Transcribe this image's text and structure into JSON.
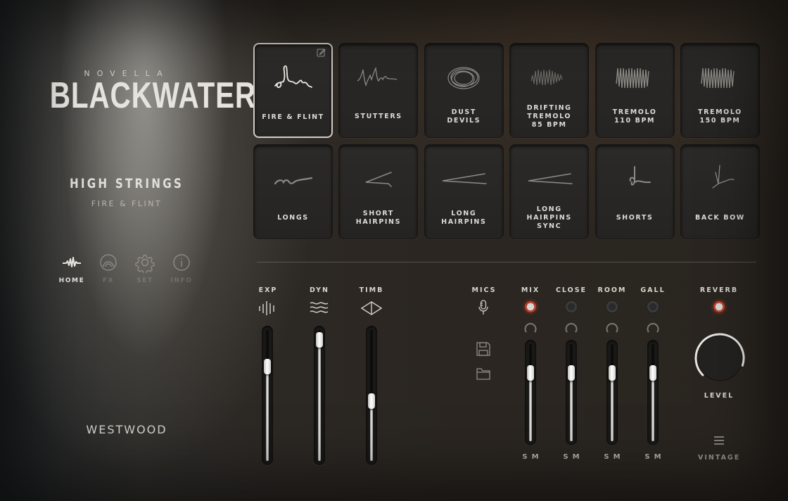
{
  "brand": {
    "subtitle": "NOVELLA",
    "title": "BLACKWATER",
    "maker": "WESTWOOD"
  },
  "patch": {
    "title": "HIGH STRINGS",
    "subtitle": "FIRE & FLINT"
  },
  "nav": [
    {
      "label": "HOME",
      "icon": "waveform-icon",
      "active": true
    },
    {
      "label": "FX",
      "icon": "fx-rings-icon",
      "active": false
    },
    {
      "label": "SET",
      "icon": "gear-icon",
      "active": false
    },
    {
      "label": "INFO",
      "icon": "info-icon",
      "active": false
    }
  ],
  "articulations": [
    {
      "label": "FIRE & FLINT",
      "glyph": "squiggle",
      "selected": true
    },
    {
      "label": "STUTTERS",
      "glyph": "stutter"
    },
    {
      "label": "DUST\nDEVILS",
      "glyph": "circles"
    },
    {
      "label": "DRIFTING\nTREMOLO\n85 BPM",
      "glyph": "tremolo-faint"
    },
    {
      "label": "TREMOLO\n110 BPM",
      "glyph": "tremolo"
    },
    {
      "label": "TREMOLO\n150 BPM",
      "glyph": "tremolo"
    },
    {
      "label": "LONGS",
      "glyph": "longs"
    },
    {
      "label": "SHORT\nHAIRPINS",
      "glyph": "hairpin-short"
    },
    {
      "label": "LONG\nHAIRPINS",
      "glyph": "hairpin-long"
    },
    {
      "label": "LONG\nHAIRPINS\nSYNC",
      "glyph": "hairpin-long"
    },
    {
      "label": "SHORTS",
      "glyph": "shorts"
    },
    {
      "label": "BACK BOW",
      "glyph": "backbow"
    }
  ],
  "controls": {
    "exp": {
      "label": "EXP",
      "icon": "expression-bars-icon",
      "value": 0.75
    },
    "dyn": {
      "label": "DYN",
      "icon": "dynamics-waves-icon",
      "value": 0.98
    },
    "timb": {
      "label": "TIMB",
      "icon": "timbre-diamond-icon",
      "value": 0.45
    }
  },
  "mics": {
    "label": "MICS",
    "save_icon": "save-preset-icon",
    "load_icon": "folder-icon",
    "channels": [
      {
        "label": "MIX",
        "enabled": true,
        "level": 0.74,
        "solo": "S",
        "mute": "M"
      },
      {
        "label": "CLOSE",
        "enabled": false,
        "level": 0.74,
        "solo": "S",
        "mute": "M"
      },
      {
        "label": "ROOM",
        "enabled": false,
        "level": 0.74,
        "solo": "S",
        "mute": "M"
      },
      {
        "label": "GALL",
        "enabled": false,
        "level": 0.74,
        "solo": "S",
        "mute": "M"
      }
    ]
  },
  "reverb": {
    "label": "REVERB",
    "enabled": true,
    "level_label": "LEVEL",
    "level": 0.9,
    "preset": "VINTAGE"
  },
  "colors": {
    "accent_red": "#b2402e",
    "text": "#dddbd5"
  }
}
